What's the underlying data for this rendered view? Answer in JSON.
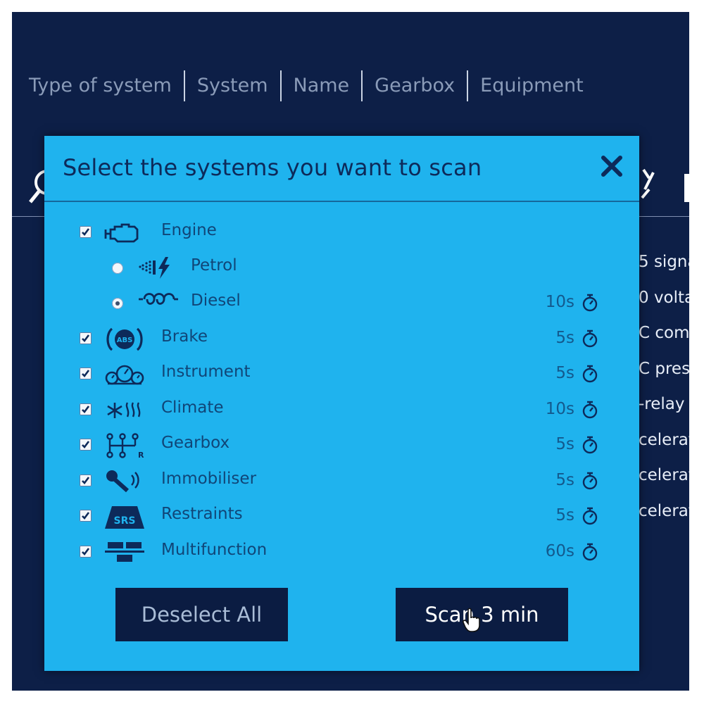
{
  "breadcrumb": [
    "Type of system",
    "System",
    "Name",
    "Gearbox",
    "Equipment"
  ],
  "background_list": [
    "5 signa",
    "0 volta",
    "C comp",
    "C press",
    "-relay",
    "celerat",
    "celerat",
    "celerat"
  ],
  "modal": {
    "title": "Select the systems you want to scan",
    "close_icon": "close-icon",
    "systems": [
      {
        "name": "Engine",
        "checked": true,
        "time": "",
        "icon": "engine-icon"
      },
      {
        "name": "Petrol",
        "radio": true,
        "selected": false,
        "time": "",
        "icon": "petrol-icon"
      },
      {
        "name": "Diesel",
        "radio": true,
        "selected": true,
        "time": "10s",
        "icon": "diesel-icon"
      },
      {
        "name": "Brake",
        "checked": true,
        "time": "5s",
        "icon": "abs-brake-icon"
      },
      {
        "name": "Instrument",
        "checked": true,
        "time": "5s",
        "icon": "instrument-cluster-icon"
      },
      {
        "name": "Climate",
        "checked": true,
        "time": "10s",
        "icon": "climate-icon"
      },
      {
        "name": "Gearbox",
        "checked": true,
        "time": "5s",
        "icon": "gearbox-icon"
      },
      {
        "name": "Immobiliser",
        "checked": true,
        "time": "5s",
        "icon": "immobiliser-key-icon"
      },
      {
        "name": "Restraints",
        "checked": true,
        "time": "5s",
        "icon": "srs-airbag-icon"
      },
      {
        "name": "Multifunction",
        "checked": true,
        "time": "60s",
        "icon": "multifunction-icon"
      }
    ],
    "deselect_label": "Deselect All",
    "scan_label": "Scan 3 min"
  },
  "colors": {
    "background": "#0d1f47",
    "modal": "#1fb3ee",
    "text_dark": "#0d2a5a",
    "button": "#0b1c42"
  }
}
